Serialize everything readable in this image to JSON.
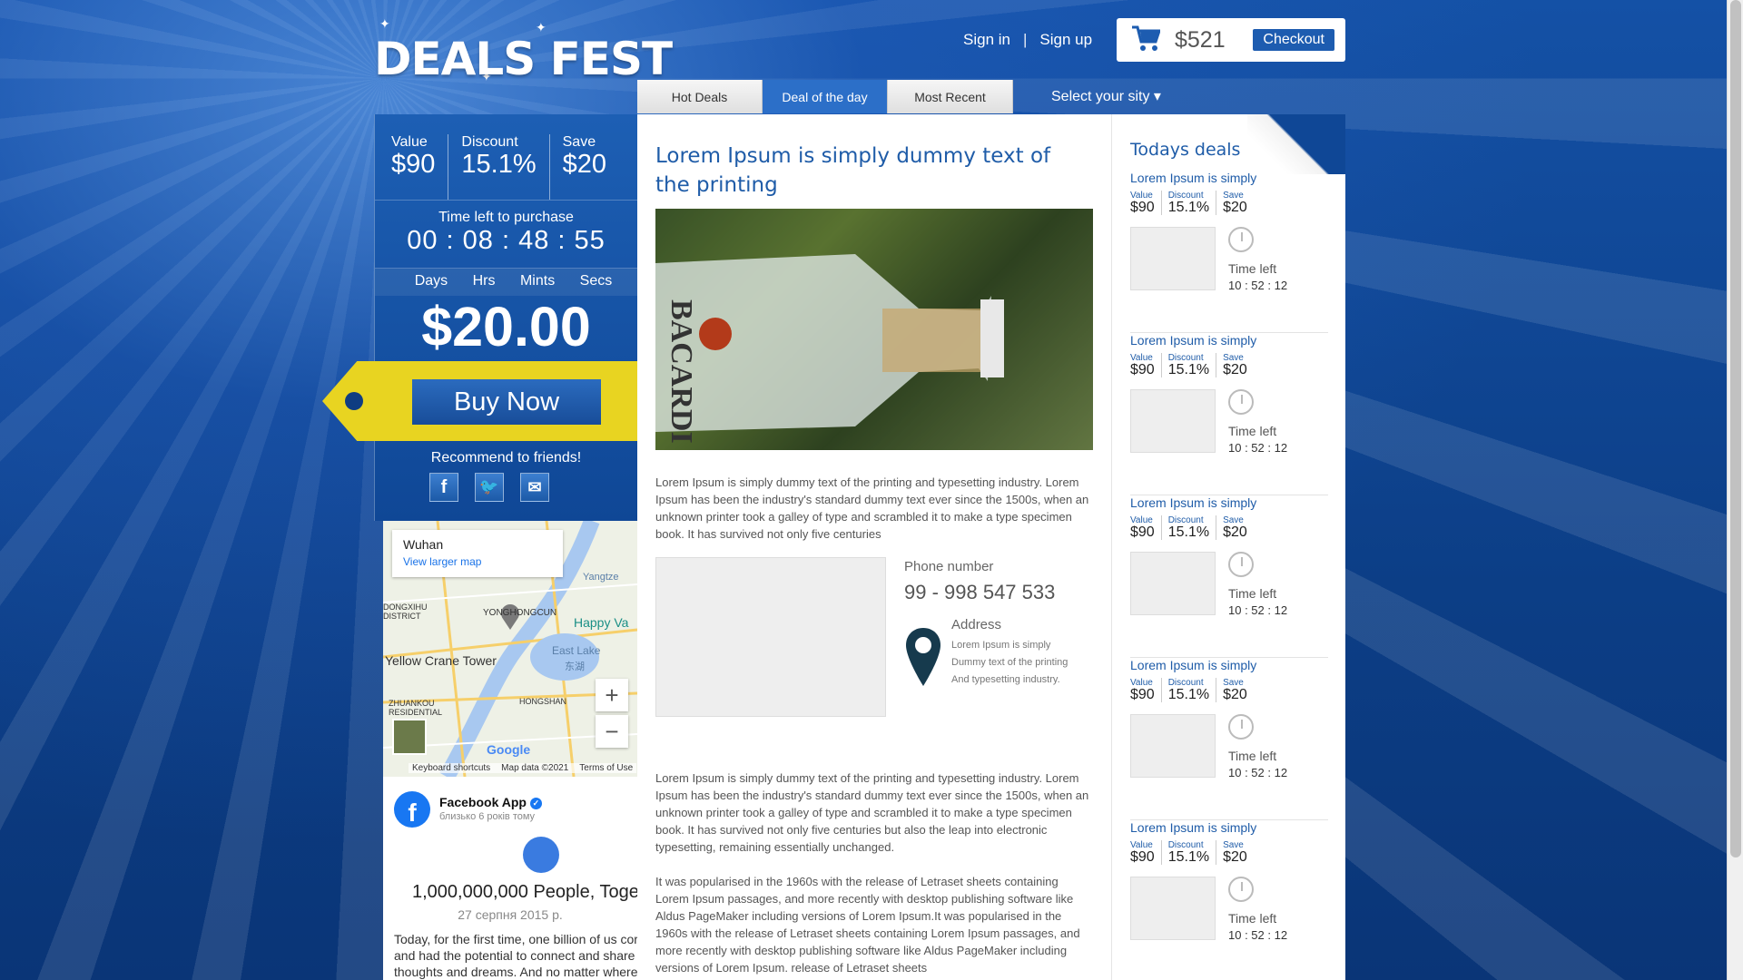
{
  "brand": {
    "logo": "DEALS FEST"
  },
  "header": {
    "sign_in": "Sign in",
    "separator": "|",
    "sign_up": "Sign up",
    "cart_total": "$521",
    "checkout": "Checkout"
  },
  "tabs": [
    {
      "label": "Hot Deals",
      "active": false
    },
    {
      "label": "Deal of the day",
      "active": true
    },
    {
      "label": "Most Recent",
      "active": false
    }
  ],
  "city_select": "Select your sity ▾",
  "deal_box": {
    "value_label": "Value",
    "value": "$90",
    "discount_label": "Discount",
    "discount": "15.1%",
    "save_label": "Save",
    "save": "$20",
    "time_left_label": "Time left to purchase",
    "countdown": "00 : 08 : 48 : 55",
    "units": [
      "Days",
      "Hrs",
      "Mints",
      "Secs"
    ],
    "price": "$20.00",
    "buy_now": "Buy Now",
    "recommend": "Recommend to friends!"
  },
  "map": {
    "place": "Wuhan",
    "view_larger": "View larger map",
    "labels": {
      "yonghongcun": "YONGHONGCUN",
      "happy_valley": "Happy Va",
      "yellow_crane": "Yellow Crane Tower",
      "east_lake": "East Lake",
      "east_lake_cn": "东湖",
      "hongshan": "HONGSHAN",
      "zhuankou": "ZHUANKOU\nRESIDENTIAL",
      "district": "DONGXIHU\nDISTRICT",
      "yangtze": "Yangtze"
    },
    "zoom_in": "+",
    "zoom_out": "−",
    "google": "Google",
    "footer": [
      "Keyboard shortcuts",
      "Map data ©2021",
      "Terms of Use"
    ]
  },
  "facebook": {
    "name": "Facebook App",
    "ago": "близько 6 років тому",
    "headline": "1,000,000,000 People, Toge",
    "date": "27 серпня 2015 р.",
    "body": [
      "Today, for the first time, one billion of us cor",
      "and had the potential to connect and share",
      "thoughts and dreams. And no matter where"
    ]
  },
  "article": {
    "title": "Lorem Ipsum is simply dummy text of the printing",
    "para1": "Lorem Ipsum is simply dummy text of the printing and typesetting industry. Lorem Ipsum has been the industry's standard dummy text ever since the 1500s, when an unknown printer took a galley of type and scrambled it to make a type specimen book. It has survived not only five centuries",
    "phone_label": "Phone number",
    "phone": "99 - 998 547 533",
    "address_label": "Address",
    "address": [
      "Lorem Ipsum is simply",
      "Dummy text of the printing",
      "And typesetting industry."
    ],
    "para2": "Lorem Ipsum is simply dummy text of the printing and typesetting industry. Lorem Ipsum has been the industry's standard dummy text ever since the 1500s, when an unknown printer took a galley of type and scrambled it to make a type specimen book. It has survived not only five centuries but also the leap into electronic typesetting, remaining essentially unchanged.",
    "para3": "It was popularised in the 1960s with the release of Letraset sheets containing Lorem Ipsum passages, and more recently with desktop publishing software like Aldus PageMaker including versions of Lorem Ipsum.It was popularised in the 1960s with the release of Letraset sheets containing Lorem Ipsum passages, and more recently with desktop publishing software like Aldus PageMaker including versions of Lorem Ipsum. release of Letraset sheets"
  },
  "todays": {
    "title": "Todays deals",
    "items": [
      {
        "title": "Lorem Ipsum is simply",
        "value_label": "Value",
        "value": "$90",
        "discount_label": "Discount",
        "discount": "15.1%",
        "save_label": "Save",
        "save": "$20",
        "time_label": "Time left",
        "time": "10 : 52 : 12"
      },
      {
        "title": "Lorem Ipsum is simply",
        "value_label": "Value",
        "value": "$90",
        "discount_label": "Discount",
        "discount": "15.1%",
        "save_label": "Save",
        "save": "$20",
        "time_label": "Time left",
        "time": "10 : 52 : 12"
      },
      {
        "title": "Lorem Ipsum is simply",
        "value_label": "Value",
        "value": "$90",
        "discount_label": "Discount",
        "discount": "15.1%",
        "save_label": "Save",
        "save": "$20",
        "time_label": "Time left",
        "time": "10 : 52 : 12"
      },
      {
        "title": "Lorem Ipsum is simply",
        "value_label": "Value",
        "value": "$90",
        "discount_label": "Discount",
        "discount": "15.1%",
        "save_label": "Save",
        "save": "$20",
        "time_label": "Time left",
        "time": "10 : 52 : 12"
      },
      {
        "title": "Lorem Ipsum is simply",
        "value_label": "Value",
        "value": "$90",
        "discount_label": "Discount",
        "discount": "15.1%",
        "save_label": "Save",
        "save": "$20",
        "time_label": "Time left",
        "time": "10 : 52 : 12"
      }
    ]
  },
  "icons": {
    "cart": "cart-icon",
    "facebook": "facebook-icon",
    "twitter": "twitter-icon",
    "mail": "mail-icon",
    "pin": "map-pin-icon",
    "clock": "clock-icon"
  },
  "colors": {
    "brand_blue": "#1d5cb0",
    "ribbon_yellow": "#e8d421",
    "link_blue": "#1f5ca8"
  }
}
